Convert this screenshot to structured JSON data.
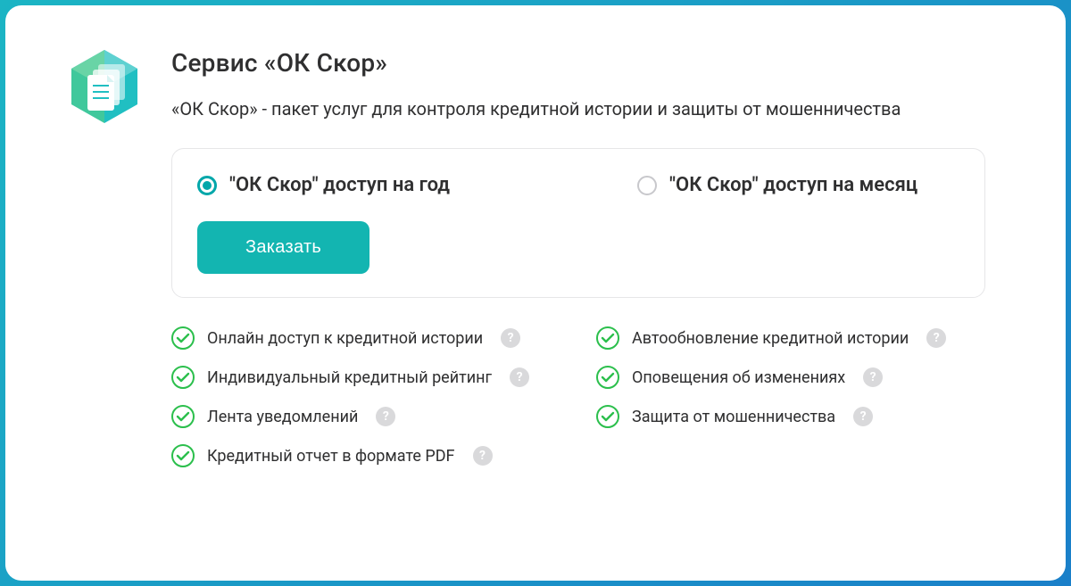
{
  "header": {
    "title": "Сервис «ОК Скор»",
    "subtitle": "«ОК Скор» - пакет услуг для контроля кредитной истории и защиты от мошенничества"
  },
  "options": {
    "year": {
      "label": "\"ОК Скор\" доступ на год",
      "selected": true
    },
    "month": {
      "label": "\"ОК Скор\" доступ на месяц",
      "selected": false
    },
    "button": "Заказать"
  },
  "features": {
    "left": [
      "Онлайн доступ к кредитной истории",
      "Индивидуальный кредитный рейтинг",
      "Лента уведомлений",
      "Кредитный отчет в формате PDF"
    ],
    "right": [
      "Автообновление кредитной истории",
      "Оповещения об изменениях",
      "Защита от мошенничества"
    ]
  },
  "glyphs": {
    "question": "?"
  }
}
